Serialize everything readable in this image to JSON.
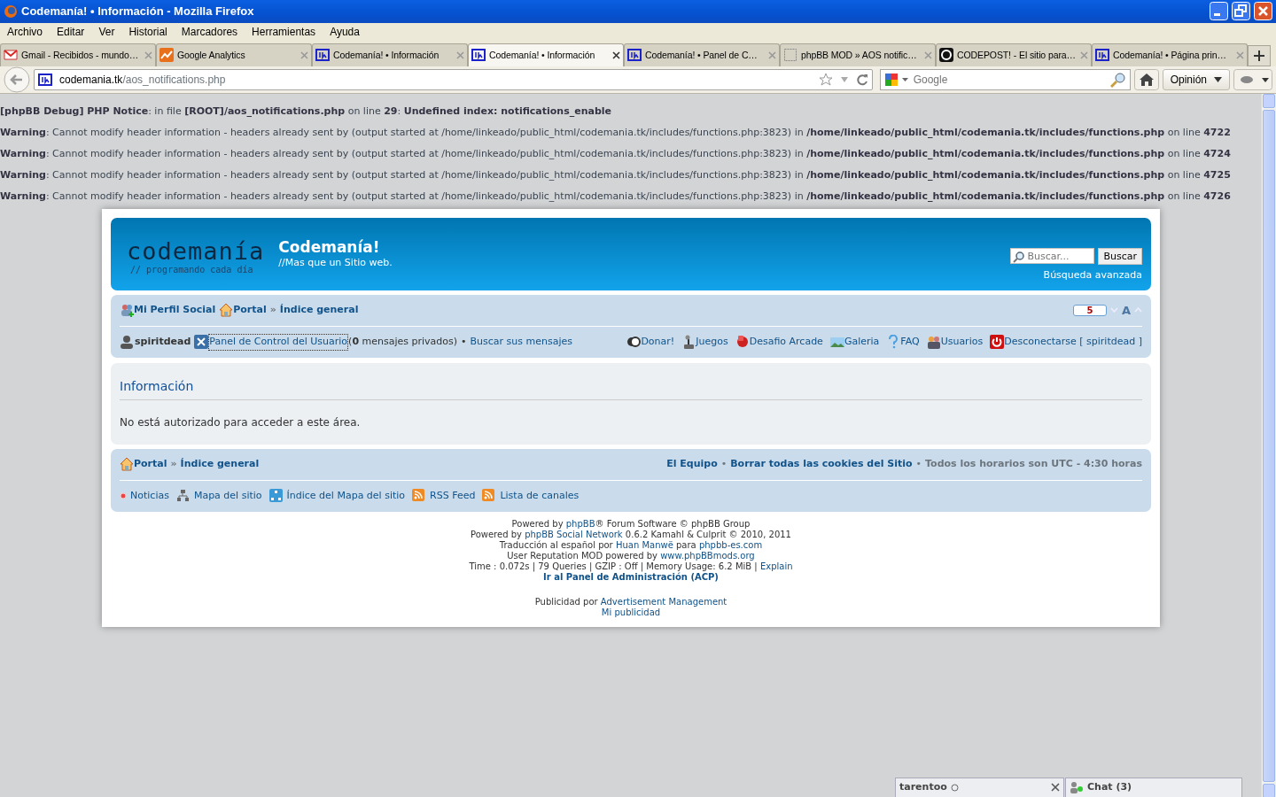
{
  "window": {
    "title": "Codemanía! • Información - Mozilla Firefox"
  },
  "menu": [
    "Archivo",
    "Editar",
    "Ver",
    "Historial",
    "Marcadores",
    "Herramientas",
    "Ayuda"
  ],
  "tabs": [
    {
      "label": "Gmail - Recibidos - mundo…",
      "selected": false
    },
    {
      "label": "Google Analytics",
      "selected": false
    },
    {
      "label": "Codemanía! • Información",
      "selected": false
    },
    {
      "label": "Codemanía! • Información",
      "selected": true
    },
    {
      "label": "Codemanía! • Panel de C…",
      "selected": false
    },
    {
      "label": "phpBB MOD » AOS notific…",
      "selected": false
    },
    {
      "label": "CODEPOST! - El sitio para…",
      "selected": false
    },
    {
      "label": "Codemanía! • Página prin…",
      "selected": false
    }
  ],
  "address": {
    "host": "codemania.tk",
    "path": "/aos_notifications.php"
  },
  "web_search": {
    "placeholder": "Google"
  },
  "feedback_button": "Opinión",
  "debug_lines": [
    "**[phpBB Debug] PHP Notice**: in file **[ROOT]/aos_notifications.php** on line **29**: **Undefined index: notifications_enable**",
    "**Warning**: Cannot modify header information - headers already sent by (output started at /home/linkeado/public_html/codemania.tk/includes/functions.php:3823) in **/home/linkeado/public_html/codemania.tk/includes/functions.php** on line **4722**",
    "**Warning**: Cannot modify header information - headers already sent by (output started at /home/linkeado/public_html/codemania.tk/includes/functions.php:3823) in **/home/linkeado/public_html/codemania.tk/includes/functions.php** on line **4724**",
    "**Warning**: Cannot modify header information - headers already sent by (output started at /home/linkeado/public_html/codemania.tk/includes/functions.php:3823) in **/home/linkeado/public_html/codemania.tk/includes/functions.php** on line **4725**",
    "**Warning**: Cannot modify header information - headers already sent by (output started at /home/linkeado/public_html/codemania.tk/includes/functions.php:3823) in **/home/linkeado/public_html/codemania.tk/includes/functions.php** on line **4726**"
  ],
  "header": {
    "logo": "codemanía",
    "slogan": "// programando cada día",
    "site_title": "Codemanía!",
    "site_description": "//Mas que un Sitio web.",
    "search_placeholder": "Buscar...",
    "search_button": "Buscar",
    "advanced_search": "Búsqueda avanzada"
  },
  "nav": {
    "breadcrumbs": [
      {
        "label": "Mi Perfil Social"
      },
      {
        "label": "Portal"
      },
      {
        "label": "»",
        "kind": "separator"
      },
      {
        "label": "Índice general"
      }
    ],
    "reputation": "5",
    "font_size": "A",
    "user": "spiritdead",
    "ucp": "Panel de Control del Usuario",
    "private_messages": "(**0** mensajes privados)",
    "bullet": "•",
    "search_own": "Buscar sus mensajes",
    "links": [
      "Donar!",
      "Juegos",
      "Desafio Arcade",
      "Galeria",
      "FAQ",
      "Usuarios",
      "Desconectarse [ spiritdead ]"
    ]
  },
  "content": {
    "title": "Información",
    "message": "No está autorizado para acceder a este área."
  },
  "footer": {
    "breadcrumbs": [
      {
        "label": "Portal"
      },
      {
        "label": "»",
        "kind": "separator"
      },
      {
        "label": "Índice general"
      }
    ],
    "right": [
      {
        "label": "El Equipo"
      },
      {
        "label": "•",
        "kind": "separator"
      },
      {
        "label": "Borrar todas las cookies del Sitio"
      },
      {
        "label": "•",
        "kind": "separator"
      },
      {
        "label": "Todos los horarios son UTC - 4:30 horas",
        "kind": "text"
      }
    ],
    "links": [
      "Noticias",
      "Mapa del sitio",
      "Índice del Mapa del sitio",
      "RSS Feed",
      "Lista de canales"
    ]
  },
  "credits": [
    {
      "kind": "plain",
      "parts": [
        {
          "text": "Powered by ",
          "kind": "text"
        },
        {
          "text": "phpBB",
          "kind": "link"
        },
        {
          "text": "® Forum Software © phpBB Group",
          "kind": "text"
        }
      ]
    },
    {
      "kind": "plain",
      "parts": [
        {
          "text": "Powered by ",
          "kind": "text"
        },
        {
          "text": "phpBB Social Network",
          "kind": "link"
        },
        {
          "text": " 0.6.2 Kamahl & Culprit © 2010, 2011",
          "kind": "text"
        }
      ]
    },
    {
      "kind": "plain",
      "parts": [
        {
          "text": "Traducción al español por ",
          "kind": "text"
        },
        {
          "text": "Huan Manwë",
          "kind": "link"
        },
        {
          "text": " para ",
          "kind": "text"
        },
        {
          "text": "phpbb-es.com",
          "kind": "link"
        }
      ]
    },
    {
      "kind": "plain",
      "parts": [
        {
          "text": "User Reputation MOD powered by ",
          "kind": "text"
        },
        {
          "text": "www.phpBBmods.org",
          "kind": "link"
        }
      ]
    },
    {
      "kind": "plain",
      "parts": [
        {
          "text": "Time : 0.072s | 79 Queries | GZIP : Off | Memory Usage: 6.2 MiB | ",
          "kind": "text"
        },
        {
          "text": "Explain",
          "kind": "link"
        }
      ]
    },
    {
      "kind": "strong",
      "parts": [
        {
          "text": "Ir al Panel de Administración (ACP)",
          "kind": "link"
        }
      ]
    }
  ],
  "ads": [
    {
      "kind": "plain",
      "parts": [
        {
          "text": "Publicidad por ",
          "kind": "text"
        },
        {
          "text": "Advertisement Management",
          "kind": "link"
        }
      ]
    },
    {
      "kind": "plain",
      "parts": [
        {
          "text": "Mi publicidad",
          "kind": "link"
        }
      ]
    }
  ],
  "chat": {
    "user": "tarentoo",
    "label": "Chat (3)"
  }
}
